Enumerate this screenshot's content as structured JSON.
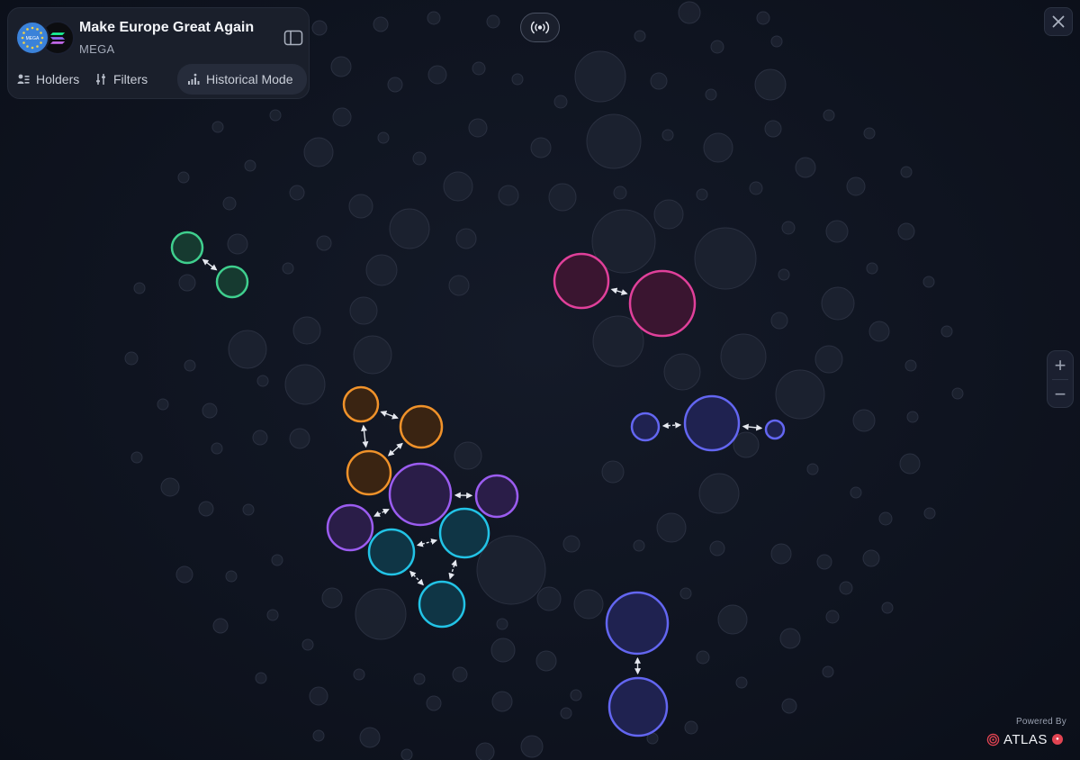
{
  "token": {
    "name": "Make Europe Great Again",
    "symbol": "MEGA",
    "logo_icon": "eu-stars-logo",
    "chain_icon": "solana-logo"
  },
  "toolbar": {
    "holders_label": "Holders",
    "filters_label": "Filters",
    "historical_label": "Historical Mode"
  },
  "controls": {
    "live_icon": "broadcast-icon",
    "close_icon": "close-icon",
    "zoom_in_label": "+",
    "zoom_out_label": "−"
  },
  "branding": {
    "powered_by": "Powered By",
    "brand_name": "ATLAS"
  },
  "colors": {
    "background": "#0f1420",
    "inactive_bubble": "#1d2331",
    "inactive_stroke": "#2a3040",
    "cluster_green": "#3fcf8e",
    "cluster_magenta": "#e0409a",
    "cluster_indigo": "#6366f1",
    "cluster_orange": "#f0922a",
    "cluster_purple": "#9b5cf0",
    "cluster_cyan": "#22c3e6",
    "atlas_accent": "#e24452"
  },
  "clusters": [
    {
      "color": "green",
      "holders": 2
    },
    {
      "color": "magenta",
      "holders": 2
    },
    {
      "color": "indigo",
      "holders": 3
    },
    {
      "color": "orange",
      "holders": 3
    },
    {
      "color": "purple",
      "holders": 3
    },
    {
      "color": "cyan",
      "holders": 3
    },
    {
      "color": "indigo",
      "holders": 2
    }
  ]
}
